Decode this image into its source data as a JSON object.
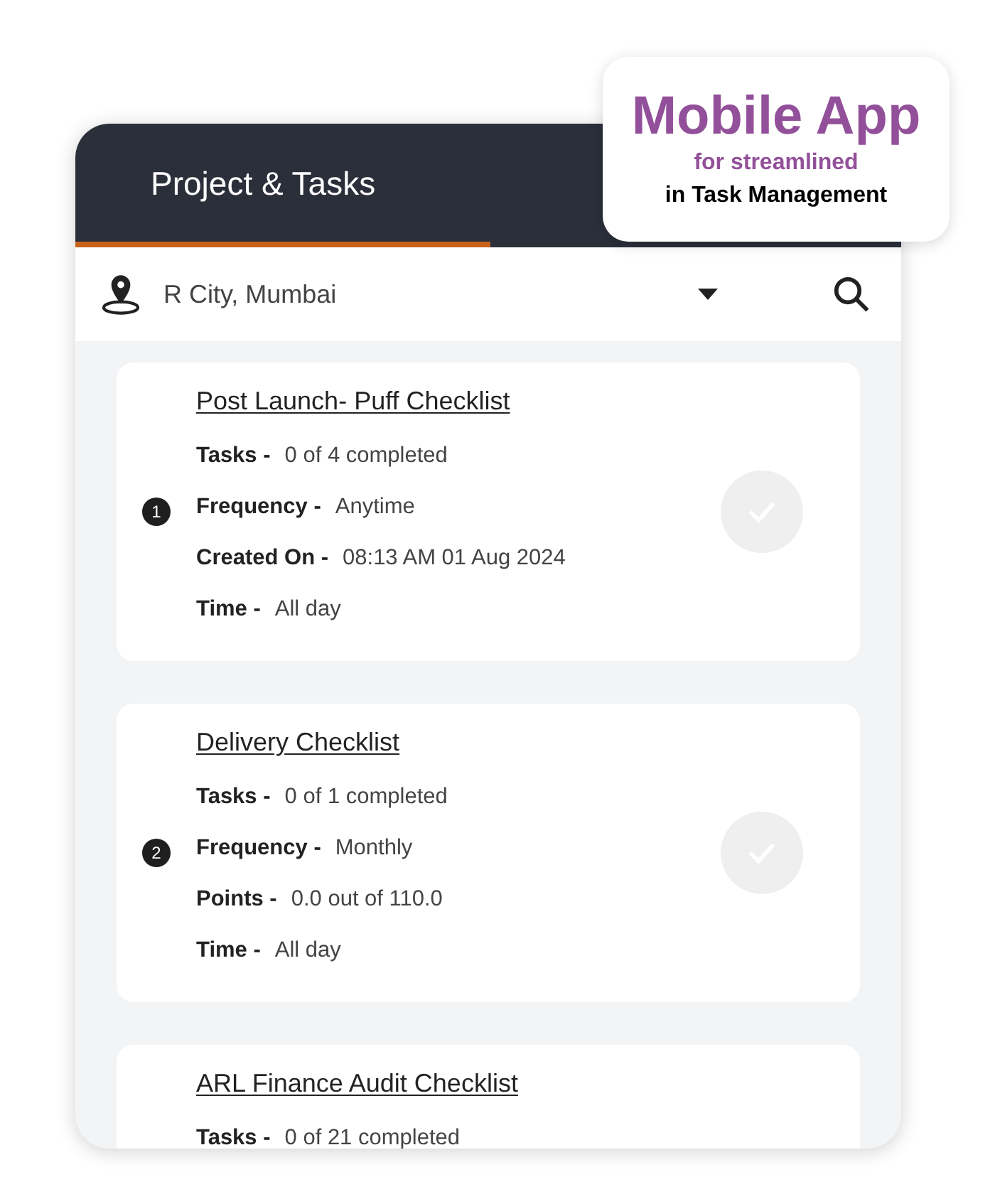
{
  "header": {
    "title": "Project & Tasks",
    "selected": true
  },
  "promo": {
    "headline": "Mobile App",
    "line_1": "for streamlined",
    "line_2": "in Task Management"
  },
  "location": {
    "value": "R City, Mumbai"
  },
  "checklists": [
    {
      "number": "1",
      "title": "Post Launch- Puff Checklist",
      "done": false,
      "fields": [
        {
          "label": "Tasks -",
          "value": "0 of 4 completed"
        },
        {
          "label": "Frequency -",
          "value": "Anytime"
        },
        {
          "label": "Created On -",
          "value": "08:13 AM 01 Aug 2024"
        },
        {
          "label": "Time -",
          "value": "All day"
        }
      ]
    },
    {
      "number": "2",
      "title": "Delivery Checklist",
      "done": false,
      "fields": [
        {
          "label": "Tasks -",
          "value": "0 of 1 completed"
        },
        {
          "label": "Frequency -",
          "value": "Monthly"
        },
        {
          "label": "Points -",
          "value": "0.0 out of 110.0"
        },
        {
          "label": "Time -",
          "value": "All day"
        }
      ]
    },
    {
      "title": "ARL Finance Audit Checklist",
      "fields": [
        {
          "label": "Tasks -",
          "value": "0 of 21 completed"
        }
      ]
    }
  ]
}
